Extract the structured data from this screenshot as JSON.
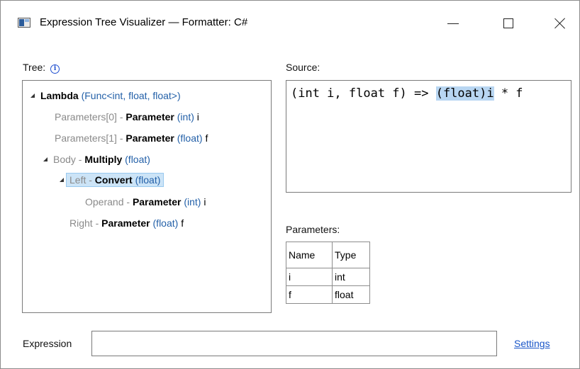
{
  "window": {
    "title": "Expression Tree Visualizer — Formatter: C#",
    "icon": "app-window-icon",
    "controls": {
      "minimize": "minimize-icon",
      "maximize": "maximize-icon",
      "close": "close-icon"
    }
  },
  "tree": {
    "label": "Tree:",
    "info_icon_glyph": "i",
    "nodes": [
      {
        "prefix": "",
        "kind": "Lambda",
        "type": "(Func<int, float, float>)",
        "name": ""
      },
      {
        "prefix": "Parameters[0] - ",
        "kind": "Parameter",
        "type": "(int)",
        "name": "i"
      },
      {
        "prefix": "Parameters[1] - ",
        "kind": "Parameter",
        "type": "(float)",
        "name": "f"
      },
      {
        "prefix": "Body - ",
        "kind": "Multiply",
        "type": "(float)",
        "name": ""
      },
      {
        "prefix": "Left - ",
        "kind": "Convert",
        "type": "(float)",
        "name": ""
      },
      {
        "prefix": "Operand - ",
        "kind": "Parameter",
        "type": "(int)",
        "name": "i"
      },
      {
        "prefix": "Right - ",
        "kind": "Parameter",
        "type": "(float)",
        "name": "f"
      }
    ]
  },
  "source": {
    "label": "Source:",
    "before": "(int i, float f) => ",
    "highlighted": "(float)i",
    "after": " * f"
  },
  "parameters": {
    "label": "Parameters:",
    "columns": [
      "Name",
      "Type"
    ],
    "rows": [
      [
        "i",
        "int"
      ],
      [
        "f",
        "float"
      ]
    ]
  },
  "expression": {
    "label": "Expression",
    "value": "",
    "placeholder": ""
  },
  "settings": {
    "link_label": "Settings"
  },
  "colors": {
    "selection_fill": "#cce4f7",
    "source_highlight": "#b8d6f2",
    "link": "#1a56c8",
    "type_text": "#2360a8"
  }
}
